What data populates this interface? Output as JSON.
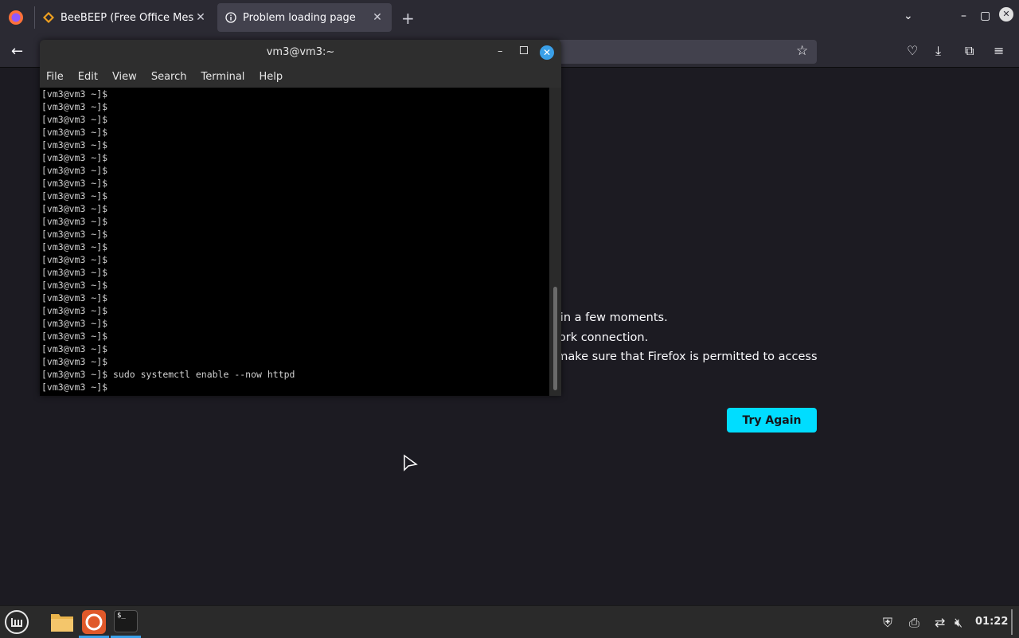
{
  "browser": {
    "tabs": [
      {
        "label": "BeeBEEP (Free Office Messa",
        "icon": "beebeep-icon",
        "active": false
      },
      {
        "label": "Problem loading page",
        "icon": "info-icon",
        "active": true
      }
    ]
  },
  "error_page": {
    "lines": [
      "n in a few moments.",
      "work connection.",
      ", make sure that Firefox is permitted to access"
    ],
    "try_again_label": "Try Again"
  },
  "terminal": {
    "title": "vm3@vm3:~",
    "menu": [
      "File",
      "Edit",
      "View",
      "Search",
      "Terminal",
      "Help"
    ],
    "lines": [
      "[vm3@vm3 ~]$",
      "[vm3@vm3 ~]$",
      "[vm3@vm3 ~]$",
      "[vm3@vm3 ~]$",
      "[vm3@vm3 ~]$",
      "[vm3@vm3 ~]$",
      "[vm3@vm3 ~]$",
      "[vm3@vm3 ~]$",
      "[vm3@vm3 ~]$",
      "[vm3@vm3 ~]$",
      "[vm3@vm3 ~]$",
      "[vm3@vm3 ~]$",
      "[vm3@vm3 ~]$",
      "[vm3@vm3 ~]$",
      "[vm3@vm3 ~]$",
      "[vm3@vm3 ~]$",
      "[vm3@vm3 ~]$",
      "[vm3@vm3 ~]$",
      "[vm3@vm3 ~]$",
      "[vm3@vm3 ~]$",
      "[vm3@vm3 ~]$",
      "[vm3@vm3 ~]$",
      "[vm3@vm3 ~]$ sudo systemctl enable --now httpd",
      "[vm3@vm3 ~]$"
    ]
  },
  "taskbar": {
    "clock": "01:22",
    "apps": [
      "files-icon",
      "firefox-icon",
      "terminal-icon"
    ]
  },
  "colors": {
    "accent": "#00ddff",
    "active_indicator": "#3aa0e8"
  }
}
